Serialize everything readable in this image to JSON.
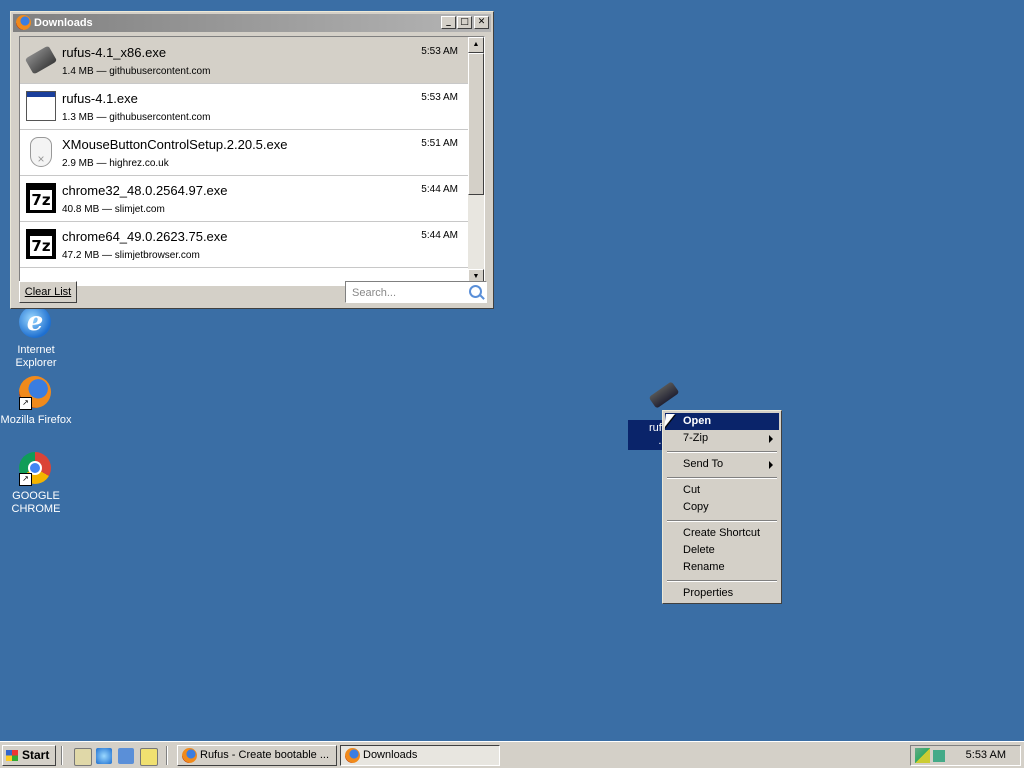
{
  "desktop": {
    "icons": [
      {
        "label": "Internet Explorer",
        "icon": "internet-explorer-icon"
      },
      {
        "label": "Mozilla Firefox",
        "icon": "firefox-icon"
      },
      {
        "label": "GOOGLE CHROME",
        "icon": "chrome-icon"
      }
    ],
    "selected_icon": {
      "label": "rufus-4.1_x86.exe",
      "label_visible": "rufus-...\n.e...",
      "icon": "usb-drive-icon"
    }
  },
  "downloads_window": {
    "title": "Downloads",
    "items": [
      {
        "name": "rufus-4.1_x86.exe",
        "details": "1.4 MB — githubusercontent.com",
        "time": "5:53 AM",
        "icon": "usb-drive-icon"
      },
      {
        "name": "rufus-4.1.exe",
        "details": "1.3 MB — githubusercontent.com",
        "time": "5:53 AM",
        "icon": "executable-window-icon"
      },
      {
        "name": "XMouseButtonControlSetup.2.20.5.exe",
        "details": "2.9 MB — highrez.co.uk",
        "time": "5:51 AM",
        "icon": "mouse-icon"
      },
      {
        "name": "chrome32_48.0.2564.97.exe",
        "details": "40.8 MB — slimjet.com",
        "time": "5:44 AM",
        "icon": "7zip-icon"
      },
      {
        "name": "chrome64_49.0.2623.75.exe",
        "details": "47.2 MB — slimjetbrowser.com",
        "time": "5:44 AM",
        "icon": "7zip-icon"
      }
    ],
    "clear_label": "Clear List",
    "search_placeholder": "Search..."
  },
  "context_menu": {
    "items": [
      "Open",
      "7-Zip",
      "Send To",
      "Cut",
      "Copy",
      "Create Shortcut",
      "Delete",
      "Rename",
      "Properties"
    ]
  },
  "taskbar": {
    "start_label": "Start",
    "tasks": [
      {
        "label": "Rufus - Create bootable ..."
      },
      {
        "label": "Downloads"
      }
    ],
    "clock": "5:53 AM"
  }
}
